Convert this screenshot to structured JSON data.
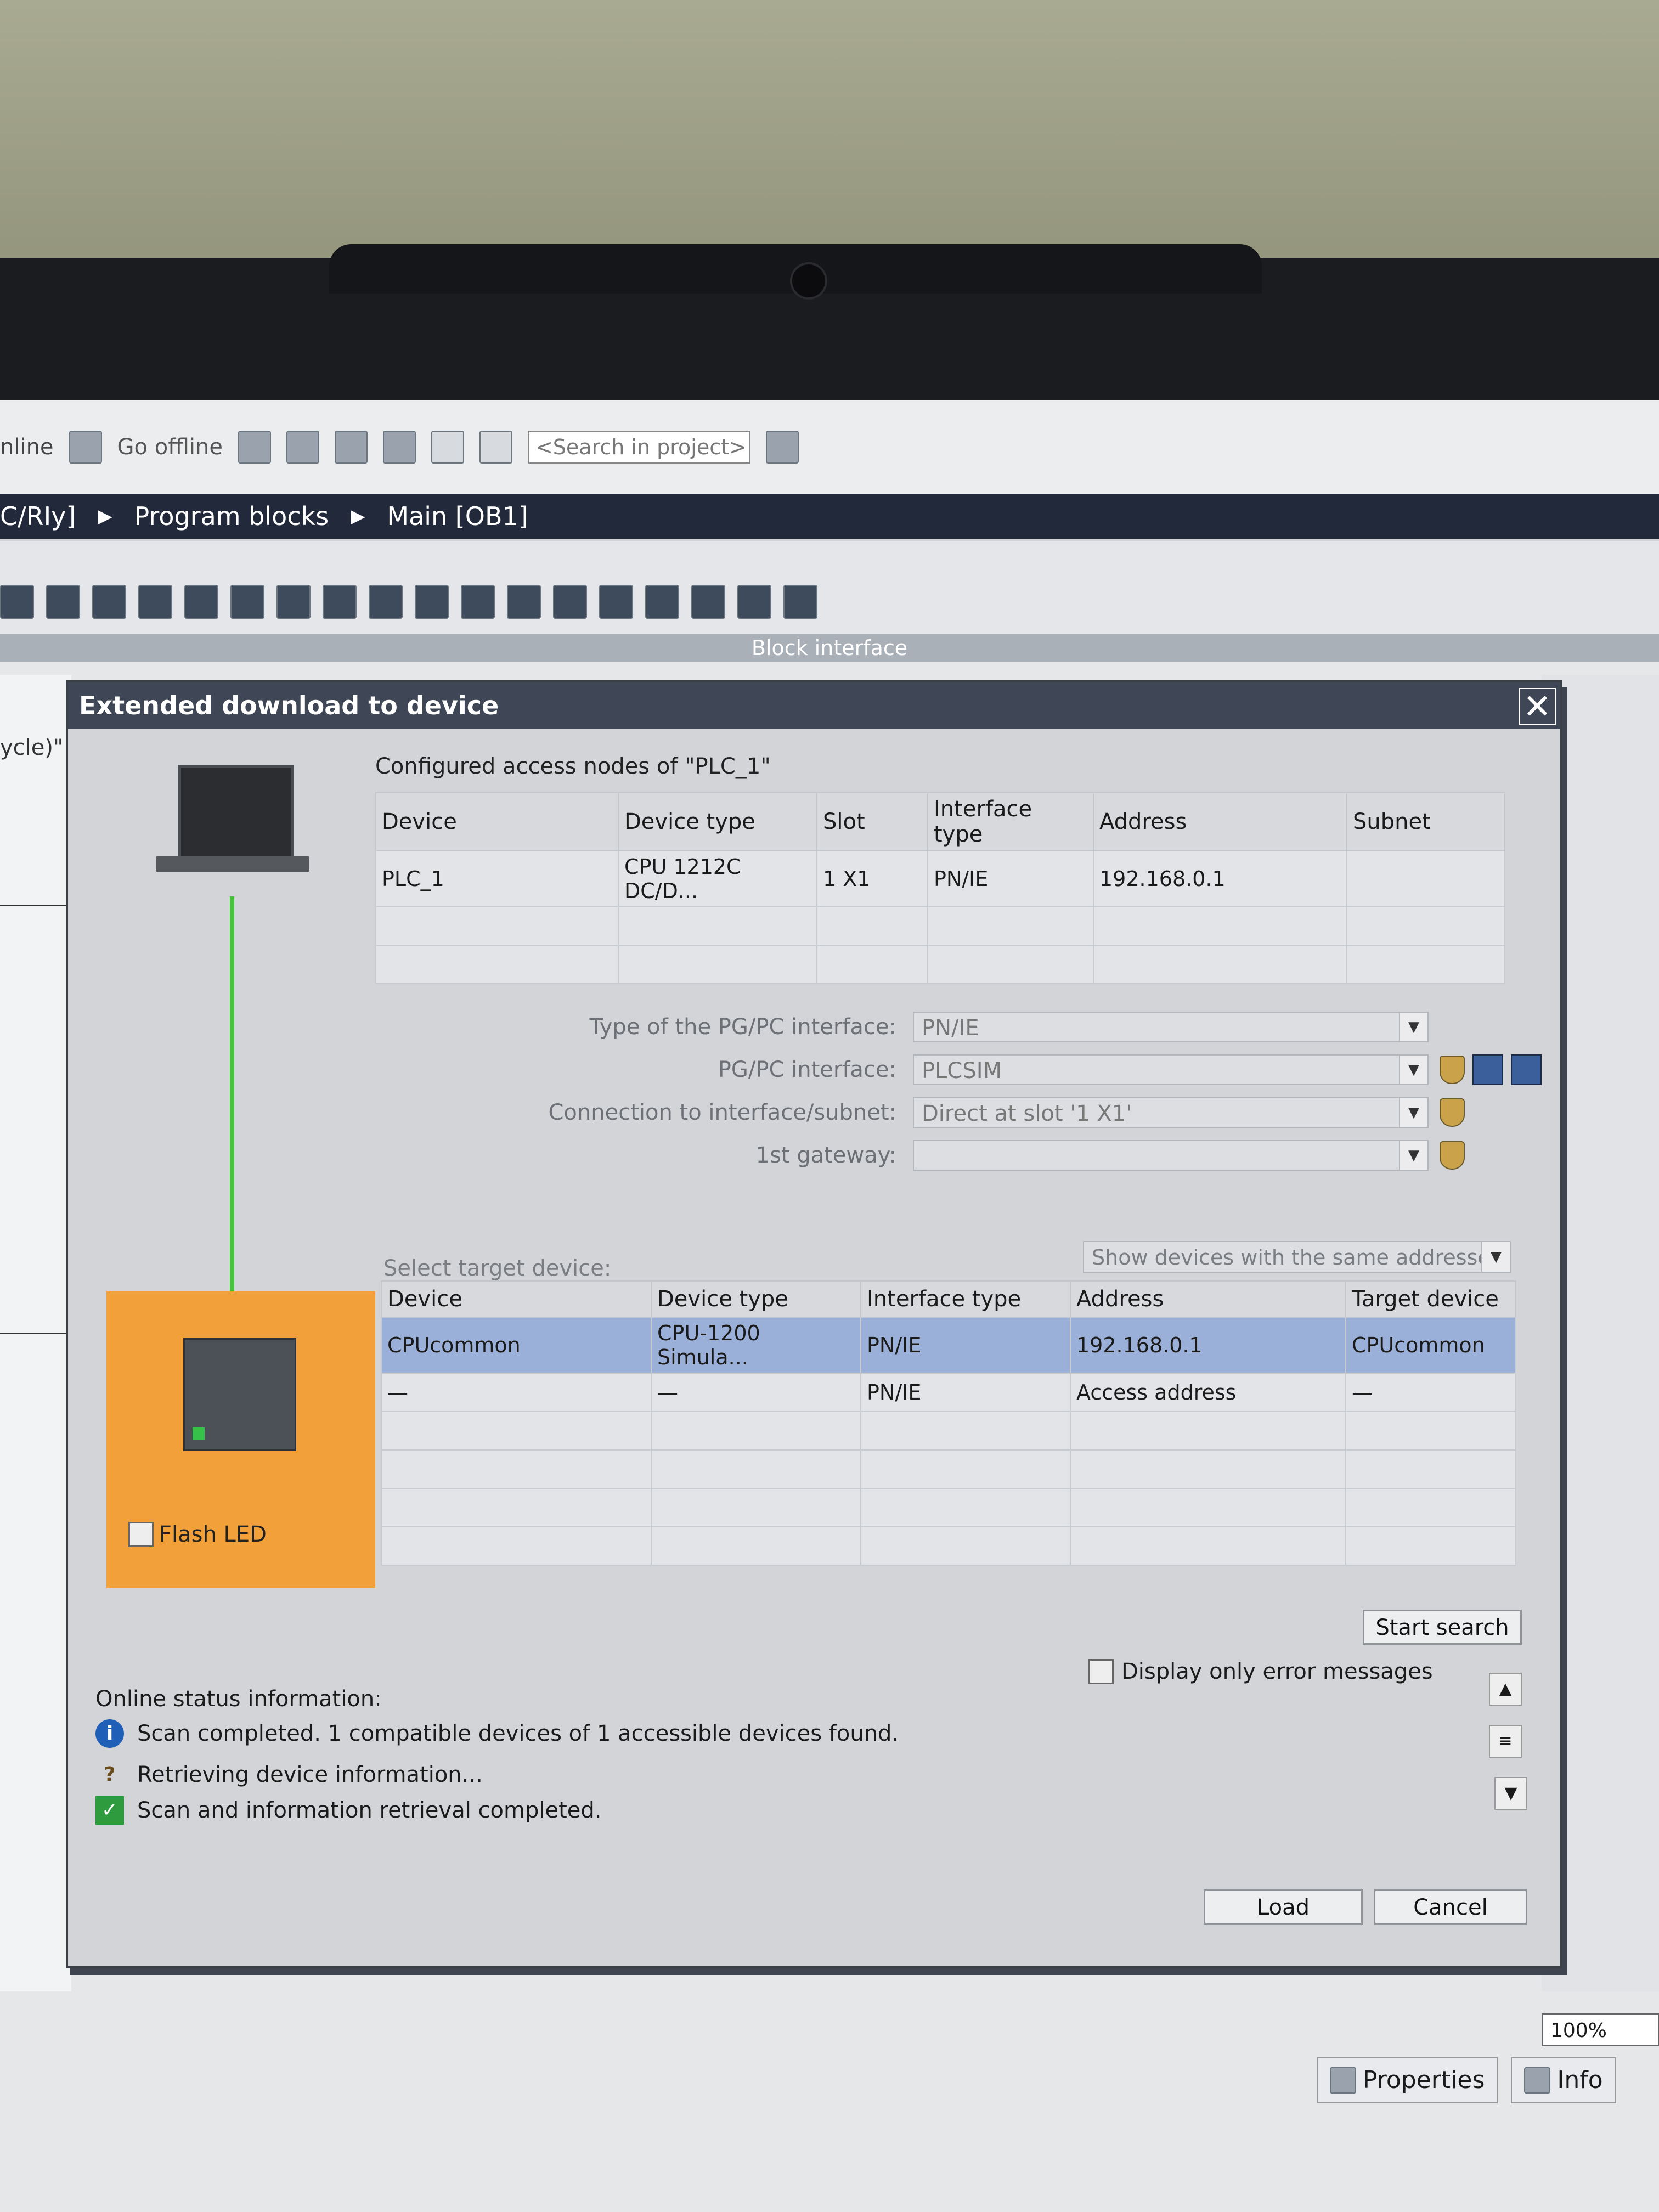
{
  "toolbar": {
    "online_label": "nline",
    "go_offline_label": "Go offline",
    "search_placeholder": "<Search in project>"
  },
  "breadcrumb": {
    "items": [
      "C/RIy]",
      "Program blocks",
      "Main [OB1]"
    ]
  },
  "editor": {
    "block_interface_label": "Block interface",
    "left_partial_label": "ycle)\""
  },
  "dialog": {
    "title": "Extended download to device",
    "configured_heading": "Configured access nodes of \"PLC_1\"",
    "configured_table": {
      "columns": [
        "Device",
        "Device type",
        "Slot",
        "Interface type",
        "Address",
        "Subnet"
      ],
      "rows": [
        [
          "PLC_1",
          "CPU 1212C DC/D...",
          "1 X1",
          "PN/IE",
          "192.168.0.1",
          ""
        ]
      ]
    },
    "form": {
      "pgpc_type_label": "Type of the PG/PC interface:",
      "pgpc_type_value": "PN/IE",
      "pgpc_interface_label": "PG/PC interface:",
      "pgpc_interface_value": "PLCSIM",
      "connection_label": "Connection to interface/subnet:",
      "connection_value": "Direct at slot '1 X1'",
      "gateway_label": "1st gateway:",
      "gateway_value": ""
    },
    "select_target_label": "Select target device:",
    "show_devices_value": "Show devices with the same addresses",
    "target_table": {
      "columns": [
        "Device",
        "Device type",
        "Interface type",
        "Address",
        "Target device"
      ],
      "rows": [
        [
          "CPUcommon",
          "CPU-1200 Simula...",
          "PN/IE",
          "192.168.0.1",
          "CPUcommon"
        ],
        [
          "—",
          "—",
          "PN/IE",
          "Access address",
          "—"
        ]
      ]
    },
    "flash_led_label": "Flash LED",
    "start_search_label": "Start search",
    "display_errors_label": "Display only error messages",
    "online_status_label": "Online status information:",
    "status_messages": [
      "Scan completed. 1 compatible devices of 1 accessible devices found.",
      "Retrieving device information...",
      "Scan and information retrieval completed."
    ],
    "load_label": "Load",
    "cancel_label": "Cancel"
  },
  "statusbar": {
    "zoom": "100%",
    "properties_label": "Properties",
    "info_label": "Info"
  }
}
